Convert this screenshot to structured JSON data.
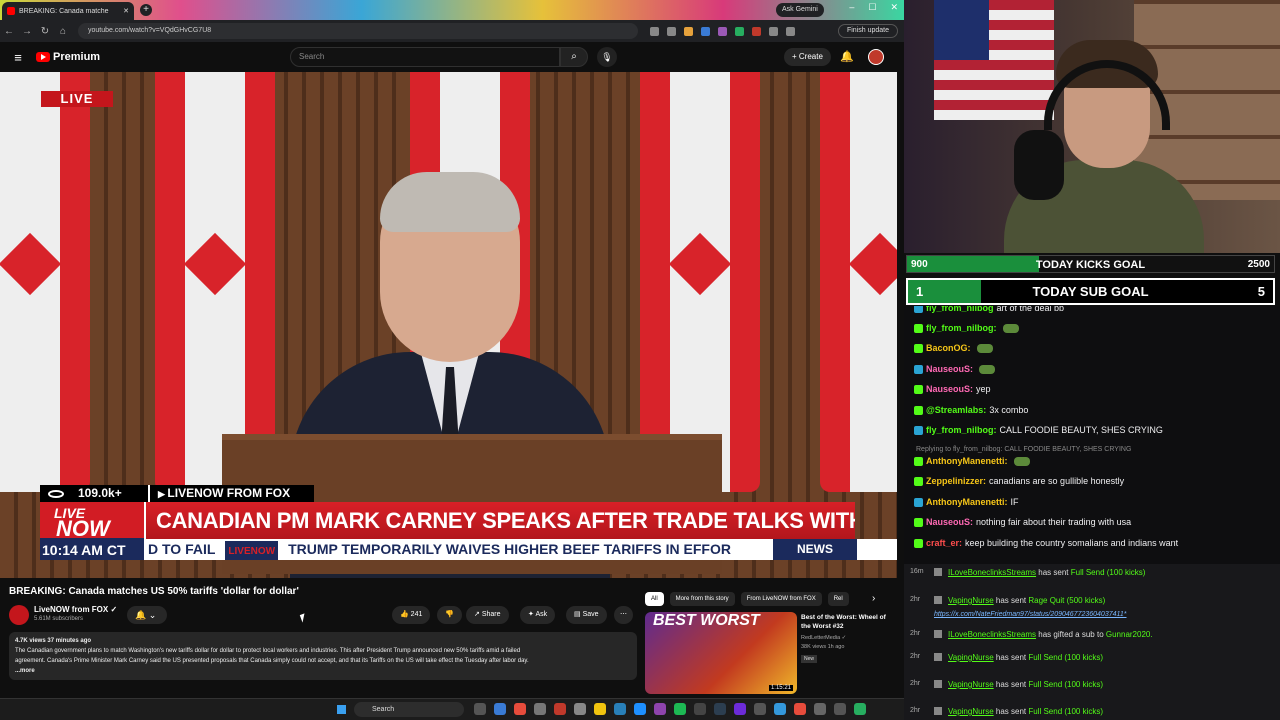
{
  "browser": {
    "tab_title": "BREAKING: Canada matche",
    "ask_gemini": "Ask Gemini",
    "url": "youtube.com/watch?v=VQdGHvCG7U8",
    "finish_update": "Finish update"
  },
  "youtube": {
    "brand": "Premium",
    "search_placeholder": "Search",
    "create_label": "+ Create",
    "video": {
      "live_badge": "LIVE",
      "viewers": "109.0k+",
      "source": "LIVENOW FROM FOX",
      "brand_top": "LIVE",
      "brand_main": "NOW",
      "time": "10:14 AM CT",
      "headline": "CANADIAN PM MARK CARNEY SPEAKS AFTER TRADE TALKS WITH U.S. BREAK DOWN",
      "ticker_left": "D TO FAIL",
      "ticker_logo": "LIVENOW",
      "ticker_right": "TRUMP TEMPORARILY WAIVES HIGHER BEEF TARIFFS IN EFFOR",
      "news_tag": "NEWS"
    },
    "title": "BREAKING: Canada matches US 50% tariffs 'dollar for dollar'",
    "channel": "LiveNOW from FOX ✓",
    "subscribers": "5.61M subscribers",
    "likes": "241",
    "share_label": "Share",
    "ask_label": "Ask",
    "save_label": "Save",
    "description": {
      "meta": "4.7K views  37 minutes ago",
      "line1": "The Canadian government plans to match Washington's new tariffs dollar for dollar to protect local workers and industries. This after President Trump announced new 50% tariffs amid a failed",
      "line2": "agreement. Canada's Prime Minister Mark Carney said the US presented proposals that Canada simply could not accept, and that its Tariffs on the US will take effect the Tuesday after labor day.",
      "more": "...more"
    },
    "chips": [
      "All",
      "More from this story",
      "From LiveNOW from FOX",
      "Rel"
    ],
    "related": {
      "thumb_text": "BEST",
      "thumb_text2": "WORST",
      "duration": "1:15:21",
      "title": "Best of the Worst: Wheel of the Worst #32",
      "channel": "RedLetterMedia ✓",
      "meta": "38K views  1h ago",
      "badge": "New"
    }
  },
  "taskbar": {
    "search_label": "Search"
  },
  "stream": {
    "kicks_goal": {
      "current": "900",
      "label": "TODAY KICKS GOAL",
      "target": "2500",
      "fraction": 0.36
    },
    "sub_goal": {
      "current": "1",
      "label": "TODAY SUB GOAL",
      "target": "5",
      "fraction": 0.2
    },
    "chat": [
      {
        "user": "fly_from_nilbog",
        "text": "art of the deal bb",
        "color": "#53fc18"
      },
      {
        "user": "fly_from_nilbog:",
        "text": "",
        "color": "#53fc18"
      },
      {
        "user": "BaconOG:",
        "text": "",
        "color": "#f5c518"
      },
      {
        "user": "NauseouS:",
        "text": "",
        "color": "#ff69b4"
      },
      {
        "user": "NauseouS:",
        "text": "yep",
        "color": "#ff69b4"
      },
      {
        "user": "@Streamlabs:",
        "text": "3x  combo",
        "color": "#53fc18"
      },
      {
        "user": "fly_from_nilbog:",
        "text": "CALL FOODIE BEAUTY, SHES CRYING",
        "color": "#53fc18"
      },
      {
        "user": "AnthonyManenetti:",
        "text": "",
        "color": "#f5c518"
      },
      {
        "user": "Zeppelinizzer:",
        "text": "canadians are so gullible honestly",
        "color": "#f5c518"
      },
      {
        "user": "AnthonyManenetti:",
        "text": "IF",
        "color": "#f5c518"
      },
      {
        "user": "NauseouS:",
        "text": "nothing fair about their trading with usa",
        "color": "#ff69b4"
      },
      {
        "user": "craft_er:",
        "text": "keep building the country somalians and indians want",
        "color": "#ff4d4d"
      }
    ],
    "reply_note": "Replying to fly_from_nilbog: CALL FOODIE BEAUTY, SHES CRYING",
    "events": [
      {
        "time": "16m",
        "user": "ILoveBoneclinksStreams",
        "action": "has sent",
        "gift": "Full Send (100 kicks)"
      },
      {
        "time": "2hr",
        "user": "VapingNurse",
        "action": "has sent",
        "gift": "Rage Quit (500 kicks)"
      },
      {
        "time": "",
        "user": "",
        "action": "",
        "gift": "",
        "link": "https://x.com/NateFriedman97/status/2090467723604037411*"
      },
      {
        "time": "2hr",
        "user": "ILoveBoneclinksStreams",
        "action": "has gifted a sub to",
        "gift": "Gunnar2020."
      },
      {
        "time": "2hr",
        "user": "VapingNurse",
        "action": "has sent",
        "gift": "Full Send (100 kicks)"
      },
      {
        "time": "2hr",
        "user": "VapingNurse",
        "action": "has sent",
        "gift": "Full Send (100 kicks)"
      },
      {
        "time": "2hr",
        "user": "VapingNurse",
        "action": "has sent",
        "gift": "Full Send (100 kicks)"
      }
    ]
  }
}
